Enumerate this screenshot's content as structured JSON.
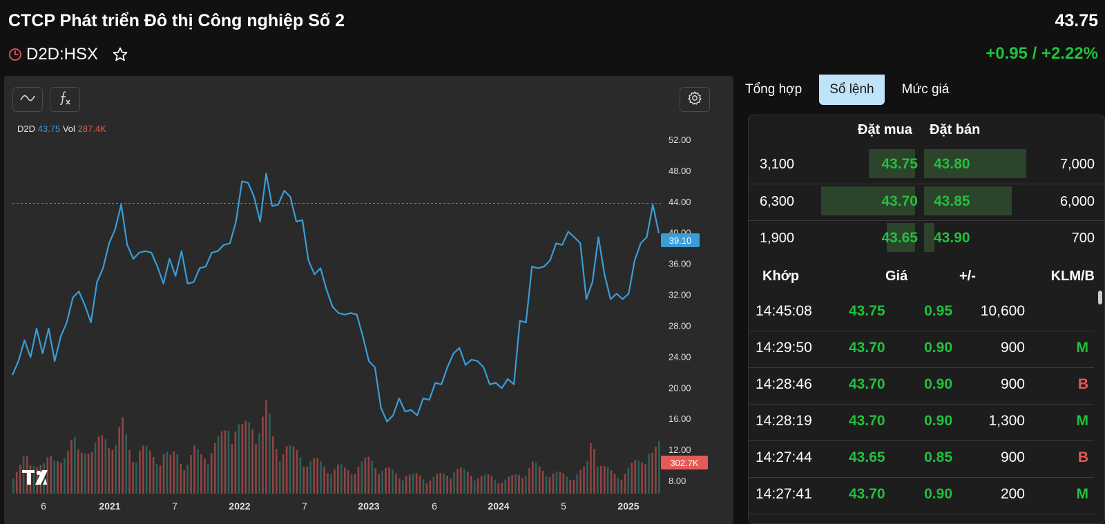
{
  "header": {
    "company_name": "CTCP Phát triển Đô thị Công nghiệp Số 2",
    "price": "43.75",
    "ticker": "D2D:HSX",
    "change": "+0.95 / +2.22%",
    "icons": [
      "clock-icon",
      "star-icon"
    ]
  },
  "chart": {
    "legend": {
      "symbol": "D2D",
      "price": "43.75",
      "vol_label": "Vol",
      "vol_value": "287.4K"
    },
    "price_tag": "39.10",
    "volume_tag": "302.7K",
    "toolbar_icons": [
      "line-chart-icon",
      "function-icon",
      "gear-icon",
      "tradingview-logo"
    ],
    "colors": {
      "line": "#3a9dd8",
      "up_volume": "#2a8f80",
      "down_volume": "#e65a55",
      "background": "#2a2a2a"
    }
  },
  "chart_data": {
    "type": "line",
    "title": "",
    "xlabel": "",
    "ylabel": "",
    "ylim": [
      6,
      54
    ],
    "y_ticks": [
      "52.00",
      "48.00",
      "44.00",
      "40.00",
      "36.00",
      "32.00",
      "28.00",
      "24.00",
      "20.00",
      "16.00",
      "12.00",
      "8.00"
    ],
    "x_ticks": [
      "6",
      "2021",
      "7",
      "2022",
      "7",
      "2023",
      "6",
      "2024",
      "5",
      "2025"
    ],
    "reference_line": 43.75,
    "series": [
      {
        "values": [
          21,
          24,
          25.5,
          24.5,
          27,
          25,
          27,
          24,
          26,
          29,
          31,
          33,
          30,
          29,
          33,
          36,
          38,
          41,
          43,
          39,
          36,
          38,
          37,
          38,
          35,
          34,
          36,
          35,
          37,
          34,
          33,
          36,
          35,
          38,
          37,
          39,
          38,
          42,
          46,
          47,
          44,
          42,
          47,
          44,
          43,
          46,
          44,
          42,
          41,
          37,
          34,
          36,
          32,
          31,
          29,
          30,
          29,
          30,
          26,
          24,
          22,
          18,
          15,
          17,
          18,
          17.5,
          16.5,
          17,
          18,
          19,
          20,
          21,
          22,
          25,
          24.5,
          23.5,
          23,
          24,
          22,
          21,
          20,
          20.5,
          20.5,
          21,
          28,
          29,
          35,
          36,
          35,
          37,
          38,
          39,
          39.5,
          40,
          38,
          32,
          33,
          40,
          34,
          32,
          31.5,
          32,
          31.5,
          37,
          38,
          40,
          43,
          40.5
        ]
      },
      {
        "name": "Vol",
        "values": [
          0.28,
          0.32,
          0.42,
          0.3,
          0.48,
          0.35,
          0.4,
          0.36,
          0.55,
          0.5,
          0.62,
          0.45,
          0.7,
          0.5,
          0.58,
          0.66,
          0.75,
          0.6,
          0.82,
          0.56,
          0.48,
          0.55,
          0.5,
          0.44,
          0.45,
          0.52,
          0.4,
          0.48,
          0.42,
          0.38,
          0.5,
          0.45,
          0.52,
          0.56,
          0.6,
          0.7,
          0.95,
          0.85,
          0.72,
          0.8,
          0.9,
          0.86,
          1.0,
          0.64,
          0.55,
          0.6,
          0.5,
          0.48,
          0.45,
          0.4,
          0.38,
          0.35,
          0.33,
          0.3,
          0.32,
          0.28,
          0.3,
          0.34,
          0.36,
          0.4,
          0.38,
          0.3,
          0.28,
          0.25,
          0.22,
          0.24,
          0.2,
          0.22,
          0.2,
          0.18,
          0.2,
          0.22,
          0.25,
          0.3,
          0.28,
          0.25,
          0.24,
          0.22,
          0.2,
          0.2,
          0.18,
          0.16,
          0.18,
          0.2,
          0.25,
          0.28,
          0.35,
          0.3,
          0.28,
          0.26,
          0.24,
          0.22,
          0.2,
          0.24,
          0.26,
          0.3,
          0.75,
          0.4,
          0.3,
          0.25,
          0.22,
          0.25,
          0.3,
          0.35,
          0.4,
          0.6,
          0.45,
          0.55
        ]
      }
    ]
  },
  "tabs": [
    {
      "label": "Tổng hợp",
      "active": false
    },
    {
      "label": "Sổ lệnh",
      "active": true
    },
    {
      "label": "Mức giá",
      "active": false
    }
  ],
  "orderbook": {
    "bid_header": "Đặt mua",
    "ask_header": "Đặt bán",
    "rows": [
      {
        "bid_volume": "3,100",
        "bid_price": "43.75",
        "ask_price": "43.80",
        "ask_volume": "7,000",
        "bid_fraction": 0.49,
        "ask_fraction": 1.0
      },
      {
        "bid_volume": "6,300",
        "bid_price": "43.70",
        "ask_price": "43.85",
        "ask_volume": "6,000",
        "bid_fraction": 1.0,
        "ask_fraction": 0.86
      },
      {
        "bid_volume": "1,900",
        "bid_price": "43.65",
        "ask_price": "43.90",
        "ask_volume": "700",
        "bid_fraction": 0.3,
        "ask_fraction": 0.1
      }
    ]
  },
  "trades": {
    "headers": {
      "time": "Khớp",
      "price": "Giá",
      "change": "+/-",
      "volume": "KLM/B"
    },
    "rows": [
      {
        "time": "14:45:08",
        "price": "43.75",
        "change": "0.95",
        "volume": "10,600",
        "side": ""
      },
      {
        "time": "14:29:50",
        "price": "43.70",
        "change": "0.90",
        "volume": "900",
        "side": "M"
      },
      {
        "time": "14:28:46",
        "price": "43.70",
        "change": "0.90",
        "volume": "900",
        "side": "B"
      },
      {
        "time": "14:28:19",
        "price": "43.70",
        "change": "0.90",
        "volume": "1,300",
        "side": "M"
      },
      {
        "time": "14:27:44",
        "price": "43.65",
        "change": "0.85",
        "volume": "900",
        "side": "B"
      },
      {
        "time": "14:27:41",
        "price": "43.70",
        "change": "0.90",
        "volume": "200",
        "side": "M"
      }
    ]
  }
}
